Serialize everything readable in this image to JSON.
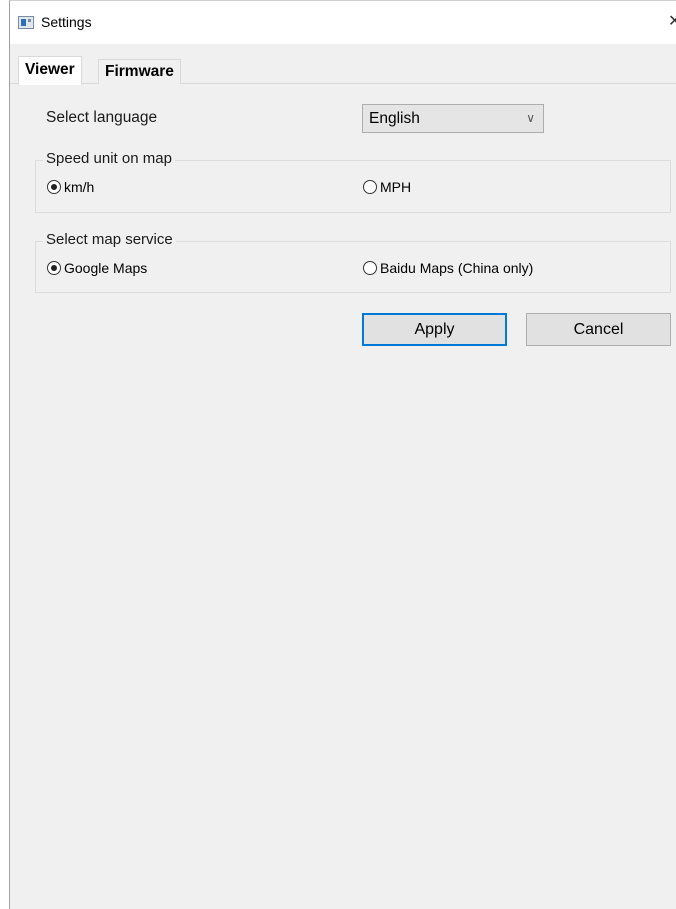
{
  "window": {
    "title": "Settings",
    "close_glyph": "✕"
  },
  "tabs": [
    {
      "label": "Viewer",
      "active": true
    },
    {
      "label": "Firmware",
      "active": false
    }
  ],
  "language": {
    "label": "Select language",
    "selected": "English",
    "arrow": "∨"
  },
  "speed_unit": {
    "legend": "Speed unit on map",
    "options": [
      {
        "label": "km/h",
        "checked": true
      },
      {
        "label": "MPH",
        "checked": false
      }
    ]
  },
  "map_service": {
    "legend": "Select map service",
    "options": [
      {
        "label": "Google Maps",
        "checked": true
      },
      {
        "label": "Baidu Maps (China only)",
        "checked": false
      }
    ]
  },
  "buttons": {
    "apply": "Apply",
    "cancel": "Cancel"
  },
  "colors": {
    "focus_border": "#0078d7",
    "window_bg": "#f0f0f0"
  }
}
